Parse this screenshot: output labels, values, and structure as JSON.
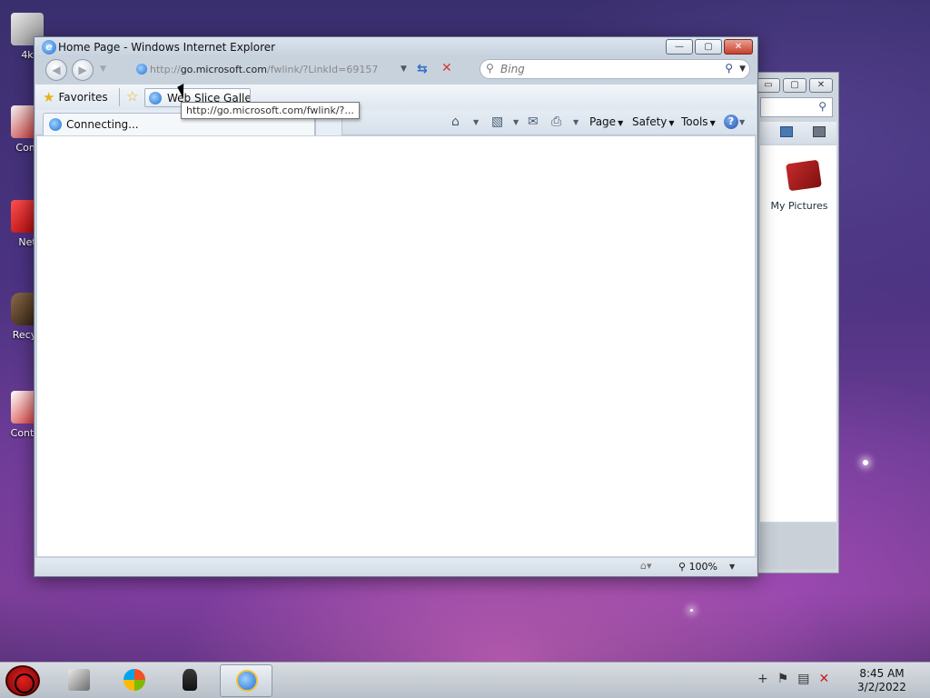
{
  "desktop": {
    "icons": [
      {
        "label": "4k"
      },
      {
        "label": "Com"
      },
      {
        "label": "Net"
      },
      {
        "label": "Recyc"
      },
      {
        "label": "Contro"
      }
    ]
  },
  "back_window": {
    "minimize": "▭",
    "maximize": "▢",
    "close": "✕",
    "item_label": "My Pictures"
  },
  "ie": {
    "title": "Home Page - Windows Internet Explorer",
    "buttons": {
      "minimize": "—",
      "maximize": "▢",
      "close": "✕"
    },
    "address": {
      "prefix": "http://",
      "host": "go.microsoft.com",
      "path": "/fwlink/?LinkId=69157"
    },
    "search": {
      "placeholder": "Bing"
    },
    "favorites": {
      "label": "Favorites",
      "web_slice": "Web Slice Gallery"
    },
    "tab": {
      "label": "Connecting..."
    },
    "commands": {
      "page": "Page",
      "safety": "Safety",
      "tools": "Tools",
      "help": "?"
    },
    "status": {
      "zoom": "100%"
    }
  },
  "tooltip": {
    "text": "http://go.microsoft.com/fwlink/?..."
  },
  "taskbar": {
    "time": "8:45 AM",
    "date": "3/2/2022"
  },
  "colors": {
    "ie_accent": "#1f6fd1",
    "close_red": "#c7402c",
    "favorites_star": "#e6b41a"
  }
}
